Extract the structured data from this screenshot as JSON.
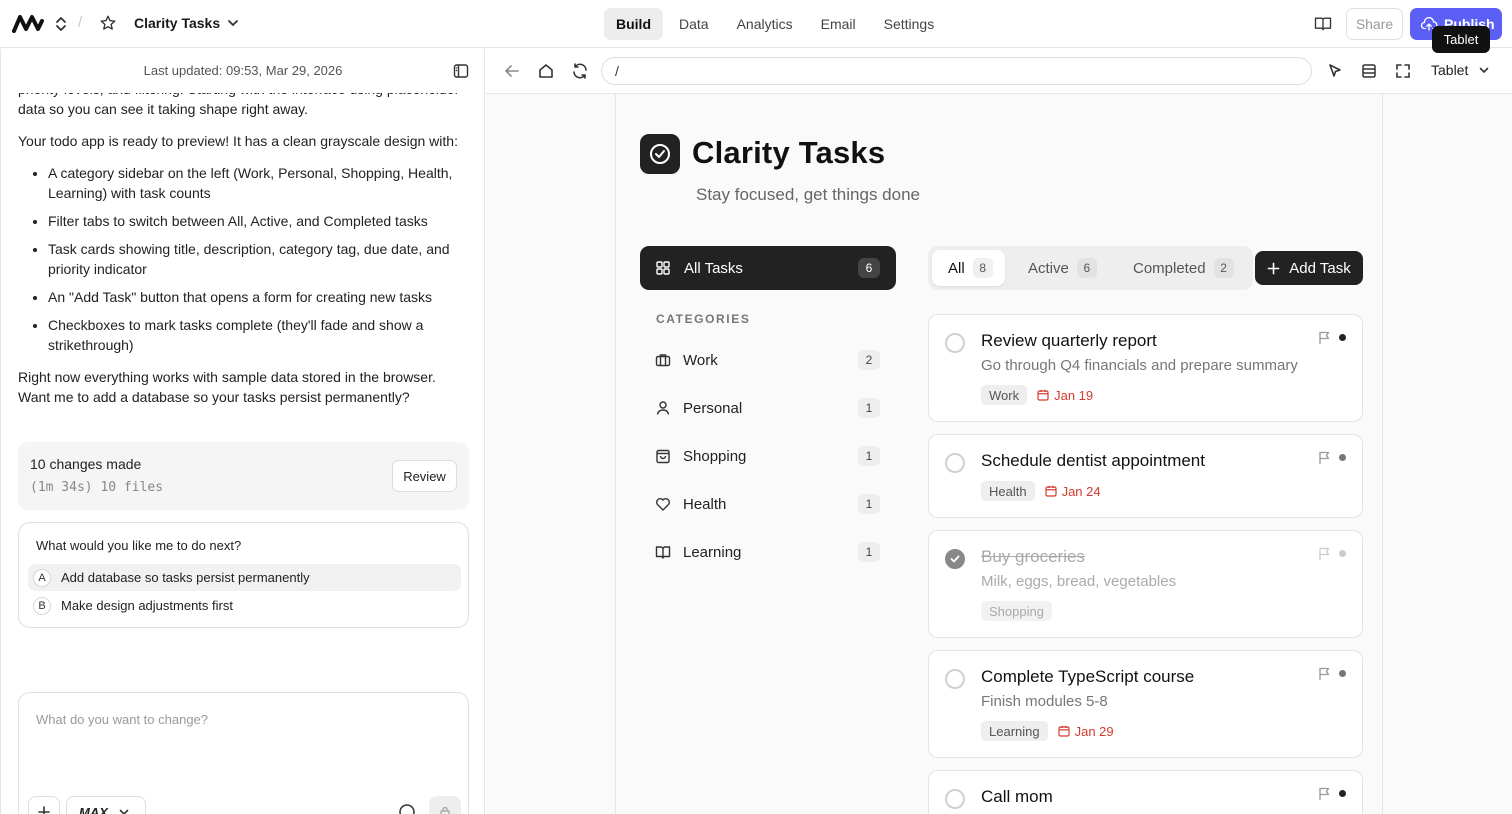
{
  "topbar": {
    "project_name": "Clarity Tasks",
    "nav_tabs": [
      "Build",
      "Data",
      "Analytics",
      "Email",
      "Settings"
    ],
    "active_tab": "Build",
    "share_label": "Share",
    "publish_label": "Publish",
    "tooltip": "Tablet"
  },
  "chat": {
    "last_updated": "Last updated: 09:53, Mar 29, 2026",
    "intro_partial": "priority levels, and filtering. Starting with the interface using placeholder data so you can see it taking shape right away.",
    "ready_line": "Your todo app is ready to preview! It has a clean grayscale design with:",
    "bullets": [
      "A category sidebar on the left (Work, Personal, Shopping, Health, Learning) with task counts",
      "Filter tabs to switch between All, Active, and Completed tasks",
      "Task cards showing title, description, category tag, due date, and priority indicator",
      "An \"Add Task\" button that opens a form for creating new tasks",
      "Checkboxes to mark tasks complete (they'll fade and show a strikethrough)"
    ],
    "closing": "Right now everything works with sample data stored in the browser. Want me to add a database so your tasks persist permanently?",
    "changes_title": "10 changes made",
    "changes_meta": "(1m 34s) 10 files",
    "review_label": "Review",
    "question": "What would you like me to do next?",
    "options": [
      {
        "letter": "A",
        "label": "Add database so tasks persist permanently"
      },
      {
        "letter": "B",
        "label": "Make design adjustments first"
      }
    ],
    "composer_placeholder": "What do you want to change?",
    "model_label": "MAX"
  },
  "preview_toolbar": {
    "url": "/",
    "device": "Tablet"
  },
  "app": {
    "title": "Clarity Tasks",
    "subtitle": "Stay focused, get things done",
    "all_tasks_label": "All Tasks",
    "all_tasks_count": "6",
    "categories_heading": "CATEGORIES",
    "categories": [
      {
        "label": "Work",
        "count": "2",
        "icon": "briefcase-icon"
      },
      {
        "label": "Personal",
        "count": "1",
        "icon": "person-icon"
      },
      {
        "label": "Shopping",
        "count": "1",
        "icon": "shopping-bag-icon"
      },
      {
        "label": "Health",
        "count": "1",
        "icon": "heart-icon"
      },
      {
        "label": "Learning",
        "count": "1",
        "icon": "book-icon"
      }
    ],
    "filters": [
      {
        "label": "All",
        "count": "8"
      },
      {
        "label": "Active",
        "count": "6"
      },
      {
        "label": "Completed",
        "count": "2"
      }
    ],
    "add_task_label": "Add Task",
    "tasks": [
      {
        "title": "Review quarterly report",
        "description": "Go through Q4 financials and prepare summary",
        "tag": "Work",
        "due": "Jan 19",
        "completed": false
      },
      {
        "title": "Schedule dentist appointment",
        "description": "",
        "tag": "Health",
        "due": "Jan 24",
        "completed": false
      },
      {
        "title": "Buy groceries",
        "description": "Milk, eggs, bread, vegetables",
        "tag": "Shopping",
        "due": "",
        "completed": true
      },
      {
        "title": "Complete TypeScript course",
        "description": "Finish modules 5-8",
        "tag": "Learning",
        "due": "Jan 29",
        "completed": false
      },
      {
        "title": "Call mom",
        "description": "",
        "tag": "",
        "due": "",
        "completed": false
      }
    ]
  },
  "colors": {
    "publish": "#5b5ff5",
    "dark": "#222222",
    "due_red": "#d33b2f"
  }
}
